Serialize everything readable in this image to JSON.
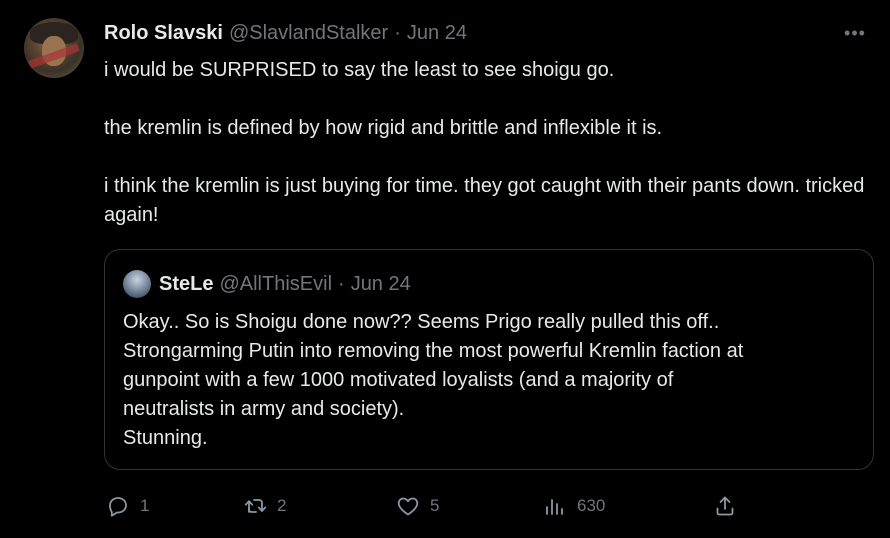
{
  "tweet": {
    "name": "Rolo Slavski",
    "handle": "@SlavlandStalker",
    "sep": "·",
    "date": "Jun 24",
    "more": "•••",
    "paragraphs": [
      "i would be SURPRISED to say the least to see shoigu go.",
      "the kremlin is defined by how rigid and brittle and inflexible it is.",
      "i think the kremlin is just buying for time. they got caught with their pants down. tricked again!"
    ]
  },
  "quoted": {
    "name": "SteLe",
    "handle": "@AllThisEvil",
    "sep": "·",
    "date": "Jun 24",
    "lines": [
      "Okay.. So is Shoigu done now?? Seems Prigo really pulled this off..",
      "Strongarming Putin into removing the most powerful Kremlin faction at",
      "gunpoint with a few 1000 motivated loyalists (and a majority of",
      "neutralists in army and society).",
      "Stunning."
    ]
  },
  "actions": {
    "reply": {
      "icon": "reply-icon",
      "count": "1"
    },
    "retweet": {
      "icon": "retweet-icon",
      "count": "2"
    },
    "like": {
      "icon": "heart-icon",
      "count": "5"
    },
    "views": {
      "icon": "views-chart-icon",
      "count": "630"
    },
    "share": {
      "icon": "share-icon"
    }
  }
}
